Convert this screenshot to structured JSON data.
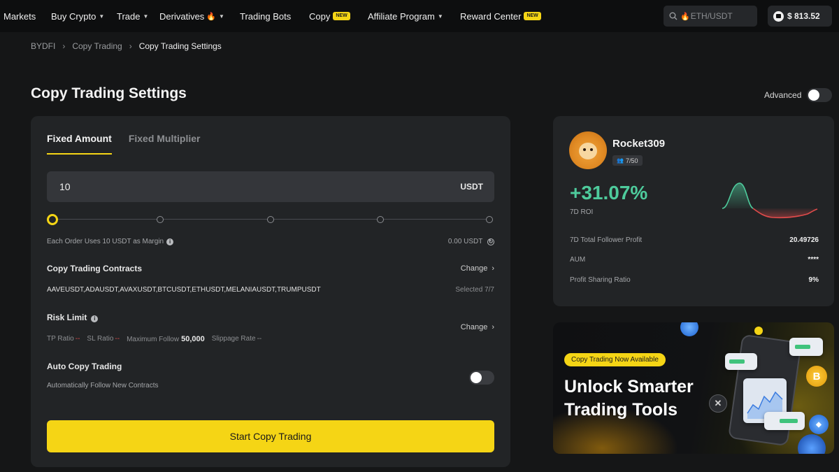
{
  "nav": {
    "items": [
      {
        "label": "Markets"
      },
      {
        "label": "Buy Crypto"
      },
      {
        "label": "Trade"
      },
      {
        "label": "Derivatives"
      },
      {
        "label": "Trading Bots"
      },
      {
        "label": "Copy"
      },
      {
        "label": "Affiliate Program"
      },
      {
        "label": "Reward Center"
      }
    ],
    "new_badge": "NEW",
    "search_placeholder": "ETH/USDT",
    "balance": "$ 813.52"
  },
  "breadcrumb": {
    "items": [
      "BYDFI",
      "Copy Trading",
      "Copy Trading Settings"
    ]
  },
  "page": {
    "title": "Copy Trading Settings",
    "advanced_label": "Advanced",
    "advanced_on": false
  },
  "settings": {
    "tabs": [
      "Fixed Amount",
      "Fixed Multiplier"
    ],
    "active_tab": 0,
    "amount_value": "10",
    "amount_unit": "USDT",
    "slider_level": 0,
    "margin_note": "Each Order Uses 10 USDT as Margin",
    "available": "0.00 USDT",
    "contracts_title": "Copy Trading Contracts",
    "change_label": "Change",
    "contracts_list": "AAVEUSDT,ADAUSDT,AVAXUSDT,BTCUSDT,ETHUSDT,MELANIAUSDT,TRUMPUSDT",
    "selected_count": "Selected 7/7",
    "risk_title": "Risk Limit",
    "tp_label": "TP Ratio",
    "sl_label": "SL Ratio",
    "tp_value": "--",
    "sl_value": "--",
    "max_follow_label": "Maximum Follow",
    "max_follow_value": "50,000",
    "slippage_label": "Slippage Rate",
    "slippage_value": "--",
    "auto_title": "Auto Copy Trading",
    "auto_subtitle": "Automatically Follow New Contracts",
    "auto_on": false,
    "start_button": "Start Copy Trading"
  },
  "trader": {
    "name": "Rocket309",
    "followers": "7/50",
    "roi": "+31.07%",
    "roi_label": "7D ROI",
    "stats": [
      {
        "label": "7D Total Follower Profit",
        "value": "20.49726"
      },
      {
        "label": "AUM",
        "value": "****"
      },
      {
        "label": "Profit Sharing Ratio",
        "value": "9%"
      }
    ],
    "colors": {
      "positive": "#4ecb9c",
      "negative": "#e04b4b"
    }
  },
  "promo": {
    "pill": "Copy Trading Now Available",
    "title": "Unlock Smarter Trading Tools"
  },
  "colors": {
    "accent": "#f5d515",
    "background": "#151617",
    "card": "#222426"
  }
}
